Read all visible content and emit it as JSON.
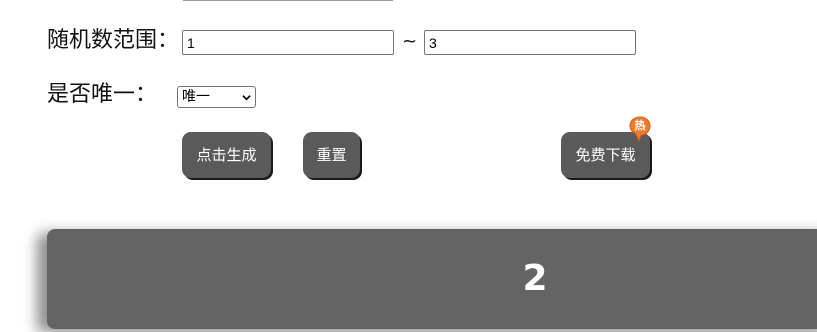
{
  "form": {
    "range_label": "随机数范围：",
    "range_min_value": "1",
    "range_separator": "~",
    "range_max_value": "3",
    "unique_label": "是否唯一：",
    "unique_selected": "唯一"
  },
  "actions": {
    "generate_label": "点击生成",
    "reset_label": "重置",
    "download_label": "免费下载",
    "hot_badge": "热"
  },
  "result": {
    "value": "2"
  },
  "colors": {
    "button_bg": "#5a5a5a",
    "result_bg": "#646464",
    "badge": "#f07b2c"
  }
}
